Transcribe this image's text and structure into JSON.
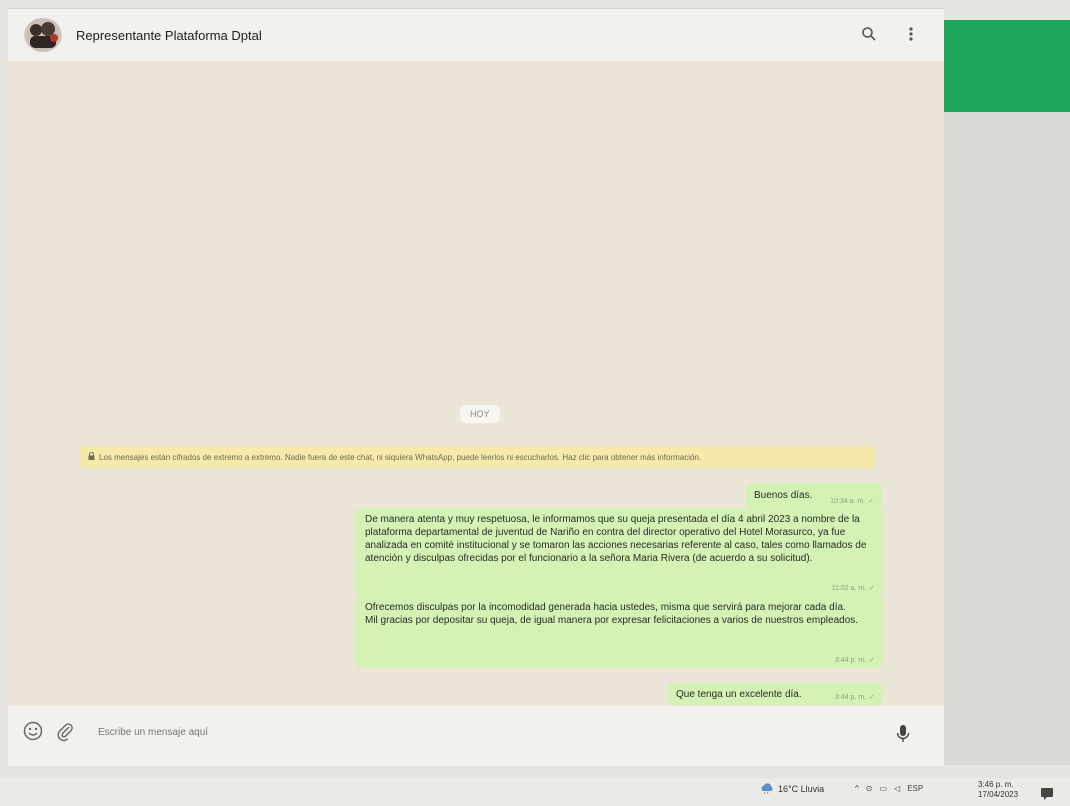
{
  "header": {
    "contact_name": "Representante Plataforma Dptal",
    "icons": [
      "search-icon",
      "menu-dots-icon"
    ]
  },
  "conversation": {
    "date_label": "HOY",
    "encryption_notice": "Los mensajes están cifrados de extremo a extremo. Nadie fuera de este chat, ni siquiera WhatsApp, puede leerlos ni escucharlos. Haz clic para obtener más información.",
    "messages": [
      {
        "text": "Buenos días.",
        "time": "10:34 a. m."
      },
      {
        "text": "De manera atenta y muy respetuosa, le informamos que su queja presentada el día 4 abril 2023 a nombre de la plataforma departamental de juventud de Nariño en contra del director operativo del Hotel Morasurco, ya fue analizada en comité institucional y se tomaron las acciones necesarias referente al caso, tales como llamados de atención y disculpas ofrecidas por el funcionario a la señora Maria Rivera (de acuerdo a su solicitud).",
        "time": "11:02 a. m."
      },
      {
        "text": "Ofrecemos disculpas por la incomodidad generada hacia ustedes, misma que servirá para mejorar cada día.\nMil gracias por depositar su queja, de igual manera por expresar felicitaciones a varios de nuestros empleados.",
        "time": "3:44 p. m."
      },
      {
        "text": "Que tenga un excelente día.",
        "time": "3:44 p. m."
      }
    ]
  },
  "composer": {
    "placeholder": "Escribe un mensaje aquí"
  },
  "taskbar": {
    "weather": "16°C Lluvia",
    "language": "ESP",
    "time": "3:46 p. m.",
    "date": "17/04/2023"
  },
  "colors": {
    "outgoing_bubble": "#d4f2b4",
    "chat_background": "#ece6d9",
    "accent_green": "#1fa65a",
    "notice_yellow": "#f6e9a9"
  }
}
